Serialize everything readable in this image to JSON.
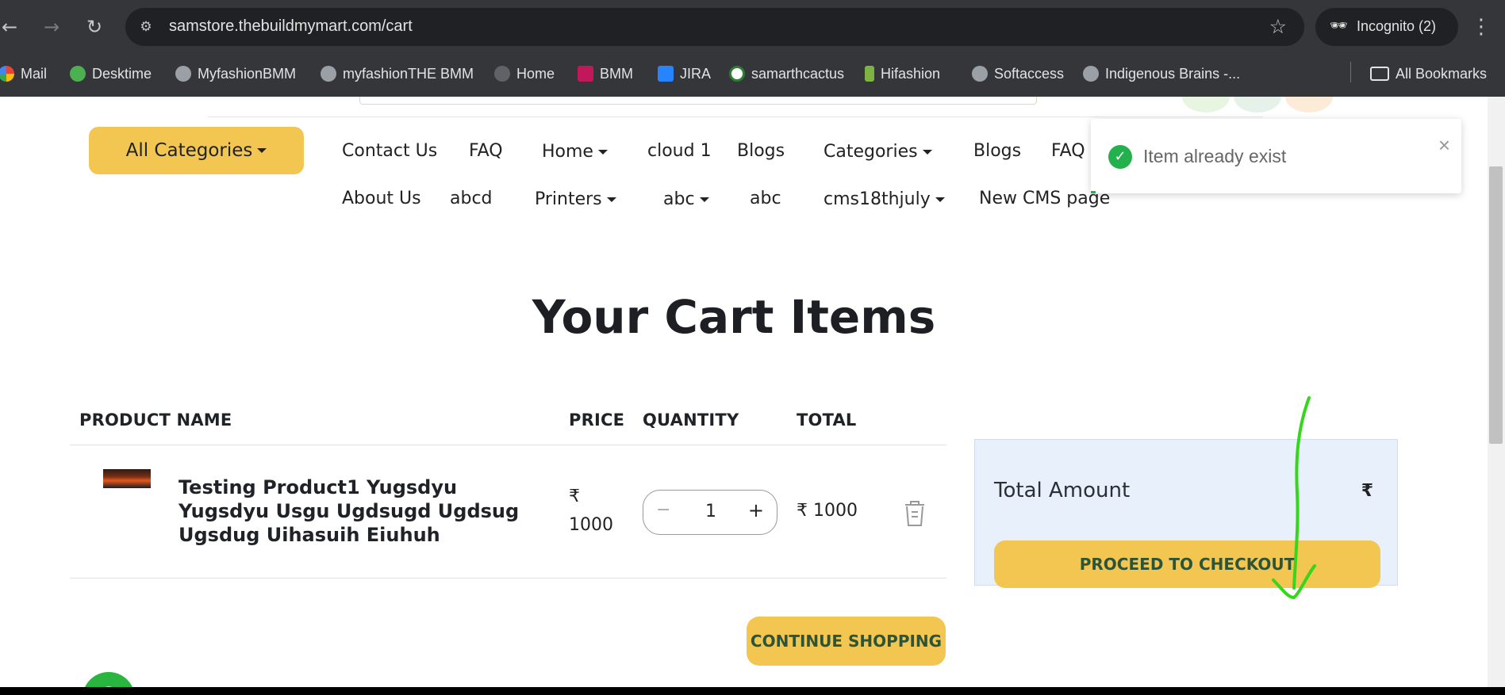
{
  "browser": {
    "url": "samstore.thebuildmymart.com/cart",
    "incognito_label": "Incognito (2)",
    "bookmarks": [
      {
        "label": "Mail",
        "icon": "google-icon"
      },
      {
        "label": "Desktime",
        "icon": "desktime-icon"
      },
      {
        "label": "MyfashionBMM",
        "icon": "globe-icon"
      },
      {
        "label": "myfashionTHE BMM",
        "icon": "globe-icon"
      },
      {
        "label": "Home",
        "icon": "globe-icon"
      },
      {
        "label": "BMM",
        "icon": "bmm-icon"
      },
      {
        "label": "JIRA",
        "icon": "jira-icon"
      },
      {
        "label": "samarthcactus",
        "icon": "samarthcactus-icon"
      },
      {
        "label": "Hifashion",
        "icon": "hifashion-icon"
      },
      {
        "label": "Softaccess",
        "icon": "globe-icon"
      },
      {
        "label": "Indigenous Brains -...",
        "icon": "globe-icon"
      }
    ],
    "all_bookmarks_label": "All Bookmarks"
  },
  "nav": {
    "all_categories": "All Categories",
    "row1": [
      {
        "label": "Contact Us",
        "dropdown": false
      },
      {
        "label": "FAQ",
        "dropdown": false
      },
      {
        "label": "Home",
        "dropdown": true
      },
      {
        "label": "cloud 1",
        "dropdown": false
      },
      {
        "label": "Blogs",
        "dropdown": false
      },
      {
        "label": "Categories",
        "dropdown": true
      },
      {
        "label": "Blogs",
        "dropdown": false
      },
      {
        "label": "FAQ",
        "dropdown": false
      }
    ],
    "row2": [
      {
        "label": "About Us",
        "dropdown": false
      },
      {
        "label": "abcd",
        "dropdown": false
      },
      {
        "label": "Printers",
        "dropdown": true
      },
      {
        "label": "abc",
        "dropdown": true
      },
      {
        "label": "abc",
        "dropdown": false
      },
      {
        "label": "cms18thjuly",
        "dropdown": true
      },
      {
        "label": "New CMS page",
        "dropdown": false
      }
    ]
  },
  "toast": {
    "message": "Item already exist",
    "close": "×"
  },
  "cart": {
    "title": "Your Cart Items",
    "headers": {
      "product": "PRODUCT NAME",
      "price": "PRICE",
      "quantity": "QUANTITY",
      "total": "TOTAL"
    },
    "items": [
      {
        "name": "Testing Product1 Yugsdyu Yugsdyu Usgu Ugdsugd Ugdsug Ugsdug Uihasuih Eiuhuh",
        "currency": "₹",
        "price": "1000",
        "quantity": "1",
        "minus": "−",
        "plus": "+",
        "total": "₹ 1000"
      }
    ],
    "continue_label": "CONTINUE SHOPPING"
  },
  "summary": {
    "total_label": "Total Amount",
    "total_value": "₹",
    "checkout_label": "PROCEED TO CHECKOUT"
  },
  "colors": {
    "accent_yellow": "#f2c651",
    "button_text_green": "#2e5437",
    "summary_bg": "#e8f0fc",
    "toast_success": "#22b14c",
    "annotation_arrow": "#35d61b"
  }
}
